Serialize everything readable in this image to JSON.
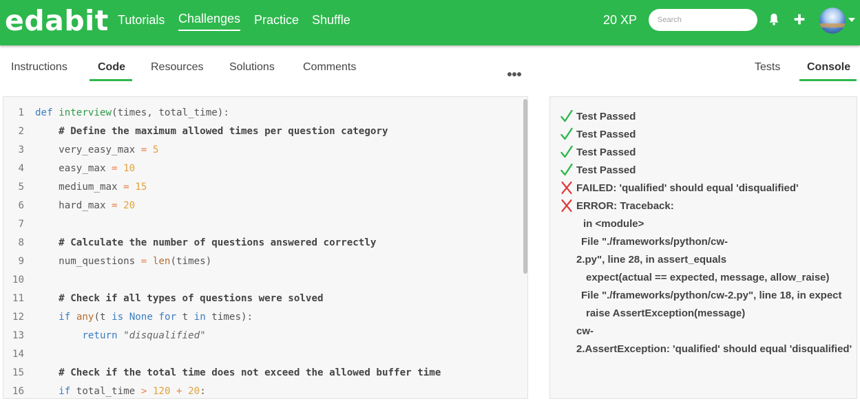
{
  "header": {
    "logo": "edabit",
    "nav": [
      "Tutorials",
      "Challenges",
      "Practice",
      "Shuffle"
    ],
    "active_nav": "Challenges",
    "xp": "20 XP",
    "search_placeholder": "Search",
    "brand_color": "#2db84d",
    "icons": [
      "bell-icon",
      "plus-icon",
      "avatar",
      "chevron-down-icon"
    ]
  },
  "left_tabs": [
    "Instructions",
    "Code",
    "Resources",
    "Solutions",
    "Comments"
  ],
  "left_active_tab": "Code",
  "more_icon": "ellipsis-icon",
  "right_tabs": [
    "Tests",
    "Console"
  ],
  "right_active_tab": "Console",
  "code": {
    "language": "python",
    "lines": [
      "def interview(times, total_time):",
      "    # Define the maximum allowed times per question category",
      "    very_easy_max = 5",
      "    easy_max = 10",
      "    medium_max = 15",
      "    hard_max = 20",
      "",
      "    # Calculate the number of questions answered correctly",
      "    num_questions = len(times)",
      "",
      "    # Check if all types of questions were solved",
      "    if any(t is None for t in times):",
      "        return \"disqualified\"",
      "",
      "    # Check if the total time does not exceed the allowed buffer time",
      "    if total_time > 120 + 20:"
    ],
    "line_numbers": [
      "1",
      "2",
      "3",
      "4",
      "5",
      "6",
      "7",
      "8",
      "9",
      "10",
      "11",
      "12",
      "13",
      "14",
      "15",
      "16"
    ]
  },
  "console": {
    "results": [
      {
        "status": "pass",
        "text": "Test Passed"
      },
      {
        "status": "pass",
        "text": "Test Passed"
      },
      {
        "status": "pass",
        "text": "Test Passed"
      },
      {
        "status": "pass",
        "text": "Test Passed"
      },
      {
        "status": "fail",
        "text": "FAILED: 'qualified' should equal 'disqualified'"
      },
      {
        "status": "fail",
        "text": "ERROR: Traceback:"
      }
    ],
    "traceback": [
      "in <module>",
      "File \"./frameworks/python/cw-",
      "2.py\", line 28, in assert_equals",
      "expect(actual == expected, message, allow_raise)",
      "File \"./frameworks/python/cw-2.py\", line 18, in expect",
      "raise AssertException(message)",
      "cw-",
      "2.AssertException: 'qualified' should equal 'disqualified'"
    ],
    "pass_color": "#2db84d",
    "fail_color": "#e03a3a"
  }
}
